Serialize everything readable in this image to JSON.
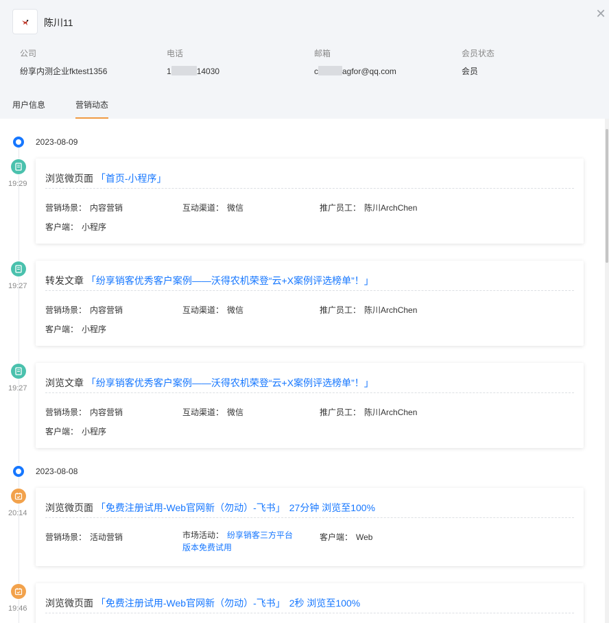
{
  "header": {
    "user_name": "陈川11",
    "close_icon": "close-icon",
    "avatar_icon": "bird-logo-icon",
    "fields": [
      {
        "label": "公司",
        "value": "纷享内测企业fktest1356"
      },
      {
        "label": "电话",
        "value_prefix": "1",
        "value_suffix": "14030"
      },
      {
        "label": "邮箱",
        "value_prefix": "c",
        "value_suffix": "agfor@qq.com"
      },
      {
        "label": "会员状态",
        "value": "会员"
      }
    ]
  },
  "tabs": [
    {
      "label": "用户信息",
      "active": false
    },
    {
      "label": "营销动态",
      "active": true
    }
  ],
  "timeline": {
    "groups": [
      {
        "date": "2023-08-09"
      },
      {
        "date": "2023-08-08"
      }
    ],
    "events": [
      {
        "time": "19:29",
        "icon": "document-icon",
        "icon_color": "#4ac1ad",
        "action": "浏览微页面",
        "link": "「首页-小程序」",
        "extra": "",
        "fields": [
          {
            "k": "营销场景：",
            "v": "内容营销"
          },
          {
            "k": "互动渠道：",
            "v": "微信"
          },
          {
            "k": "推广员工：",
            "v": "陈川ArchChen"
          },
          {
            "k": "客户端：",
            "v": "小程序"
          }
        ]
      },
      {
        "time": "19:27",
        "icon": "document-icon",
        "icon_color": "#4ac1ad",
        "action": "转发文章",
        "link": "「纷享销客优秀客户案例——沃得农机荣登“云+X案例评选榜单”！」",
        "extra": "",
        "fields": [
          {
            "k": "营销场景：",
            "v": "内容营销"
          },
          {
            "k": "互动渠道：",
            "v": "微信"
          },
          {
            "k": "推广员工：",
            "v": "陈川ArchChen"
          },
          {
            "k": "客户端：",
            "v": "小程序"
          }
        ]
      },
      {
        "time": "19:27",
        "icon": "document-icon",
        "icon_color": "#4ac1ad",
        "action": "浏览文章",
        "link": "「纷享销客优秀客户案例——沃得农机荣登“云+X案例评选榜单”！」",
        "extra": "",
        "fields": [
          {
            "k": "营销场景：",
            "v": "内容营销"
          },
          {
            "k": "互动渠道：",
            "v": "微信"
          },
          {
            "k": "推广员工：",
            "v": "陈川ArchChen"
          },
          {
            "k": "客户端：",
            "v": "小程序"
          }
        ]
      },
      {
        "time": "20:14",
        "icon": "calendar-check-icon",
        "icon_color": "#f2a24c",
        "action": "浏览微页面",
        "link": "「免费注册试用-Web官网新（勿动）-飞书」",
        "extra": "27分钟 浏览至100%",
        "fields": [
          {
            "k": "营销场景：",
            "v": "活动营销"
          },
          {
            "k": "市场活动：",
            "v_line1": "纷享销客三方平台",
            "v_line2": "版本免费试用"
          },
          {
            "k": "客户端：",
            "v": "Web"
          }
        ]
      },
      {
        "time": "19:46",
        "icon": "calendar-check-icon",
        "icon_color": "#f2a24c",
        "action": "浏览微页面",
        "link": "「免费注册试用-Web官网新（勿动）-飞书」",
        "extra": "2秒 浏览至100%"
      }
    ]
  }
}
